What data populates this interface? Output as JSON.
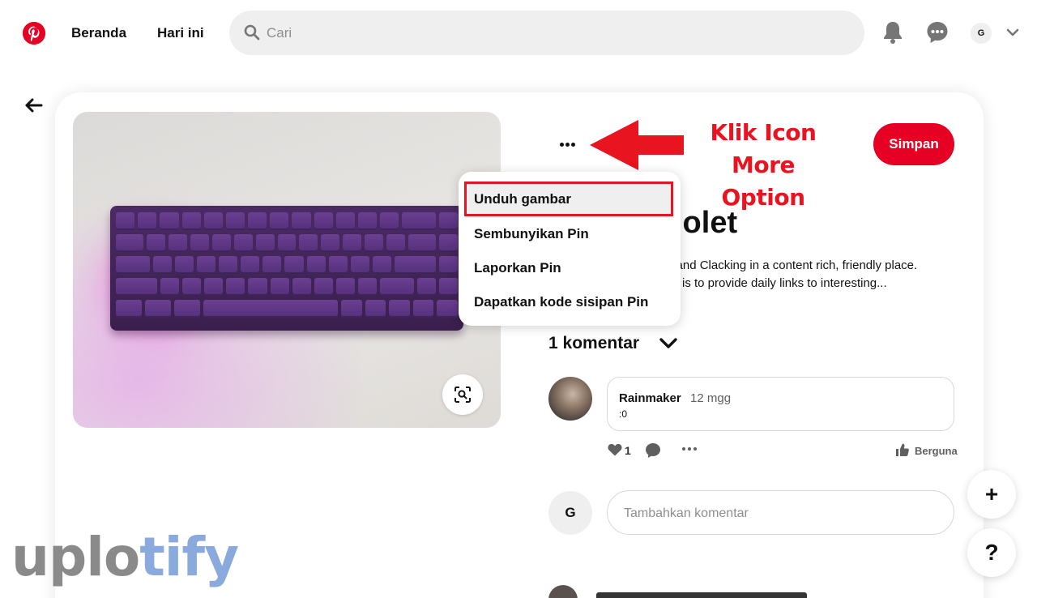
{
  "header": {
    "nav": [
      "Beranda",
      "Hari ini"
    ],
    "search_placeholder": "Cari",
    "avatar_initial": "G",
    "brand_color": "#e60023"
  },
  "pin": {
    "save_label": "Simpan",
    "title_visible": "iolet",
    "description_line1": "g and Clacking in a content rich, friendly place.",
    "description_line2": "dit is to provide daily links to interesting..."
  },
  "menu": {
    "items": [
      "Unduh gambar",
      "Sembunyikan Pin",
      "Laporkan Pin",
      "Dapatkan kode sisipan Pin"
    ]
  },
  "annotation": {
    "line1": "Klik Icon",
    "line2": "More Option",
    "color": "#e8141f"
  },
  "comments": {
    "heading": "1 komentar",
    "items": [
      {
        "user": "Rainmaker",
        "time": "12 mgg",
        "text": ":0",
        "likes": "1",
        "helpful_label": "Berguna"
      }
    ],
    "add_avatar_initial": "G",
    "add_placeholder": "Tambahkan komentar"
  },
  "floating": {
    "add": "+",
    "help": "?"
  },
  "watermark": {
    "part1": "uplo",
    "part2": "tify"
  }
}
